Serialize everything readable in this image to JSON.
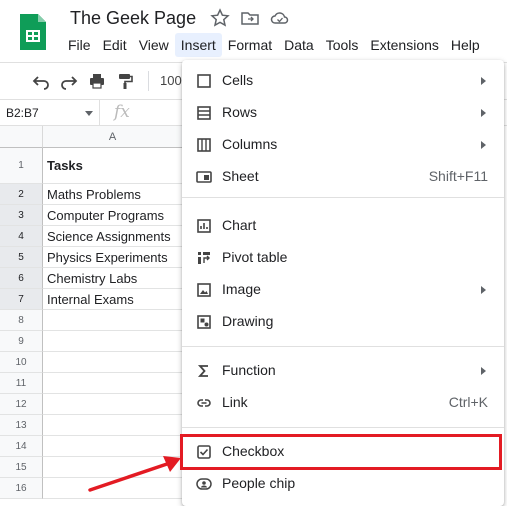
{
  "header": {
    "doc_title": "The Geek Page",
    "menus": [
      "File",
      "Edit",
      "View",
      "Insert",
      "Format",
      "Data",
      "Tools",
      "Extensions",
      "Help"
    ],
    "active_menu": "Insert"
  },
  "toolbar": {
    "zoom": "100"
  },
  "formula_bar": {
    "name_box": "B2:B7",
    "fx": "fx"
  },
  "grid": {
    "column_header": "A",
    "rows": [
      {
        "num": "1",
        "value": "Tasks",
        "bold": true
      },
      {
        "num": "2",
        "value": "Maths Problems"
      },
      {
        "num": "3",
        "value": "Computer Programs"
      },
      {
        "num": "4",
        "value": "Science Assignments"
      },
      {
        "num": "5",
        "value": "Physics Experiments"
      },
      {
        "num": "6",
        "value": "Chemistry Labs"
      },
      {
        "num": "7",
        "value": "Internal Exams"
      },
      {
        "num": "8",
        "value": ""
      },
      {
        "num": "9",
        "value": ""
      },
      {
        "num": "10",
        "value": ""
      },
      {
        "num": "11",
        "value": ""
      },
      {
        "num": "12",
        "value": ""
      },
      {
        "num": "13",
        "value": ""
      },
      {
        "num": "14",
        "value": ""
      },
      {
        "num": "15",
        "value": ""
      },
      {
        "num": "16",
        "value": ""
      }
    ]
  },
  "insert_menu": {
    "items": [
      {
        "label": "Cells",
        "icon": "cells-icon",
        "submenu": true
      },
      {
        "label": "Rows",
        "icon": "rows-icon",
        "submenu": true
      },
      {
        "label": "Columns",
        "icon": "columns-icon",
        "submenu": true
      },
      {
        "label": "Sheet",
        "icon": "sheet-icon",
        "shortcut": "Shift+F11"
      },
      {
        "label": "Chart",
        "icon": "chart-icon"
      },
      {
        "label": "Pivot table",
        "icon": "pivot-table-icon"
      },
      {
        "label": "Image",
        "icon": "image-icon",
        "submenu": true
      },
      {
        "label": "Drawing",
        "icon": "drawing-icon"
      },
      {
        "label": "Function",
        "icon": "sigma-icon",
        "submenu": true
      },
      {
        "label": "Link",
        "icon": "link-icon",
        "shortcut": "Ctrl+K"
      },
      {
        "label": "Checkbox",
        "icon": "checkbox-icon"
      },
      {
        "label": "People chip",
        "icon": "people-chip-icon"
      }
    ]
  },
  "colors": {
    "accent": "#0f9d58",
    "highlight": "#e31b23",
    "active_menu_bg": "#e8f0fe"
  }
}
